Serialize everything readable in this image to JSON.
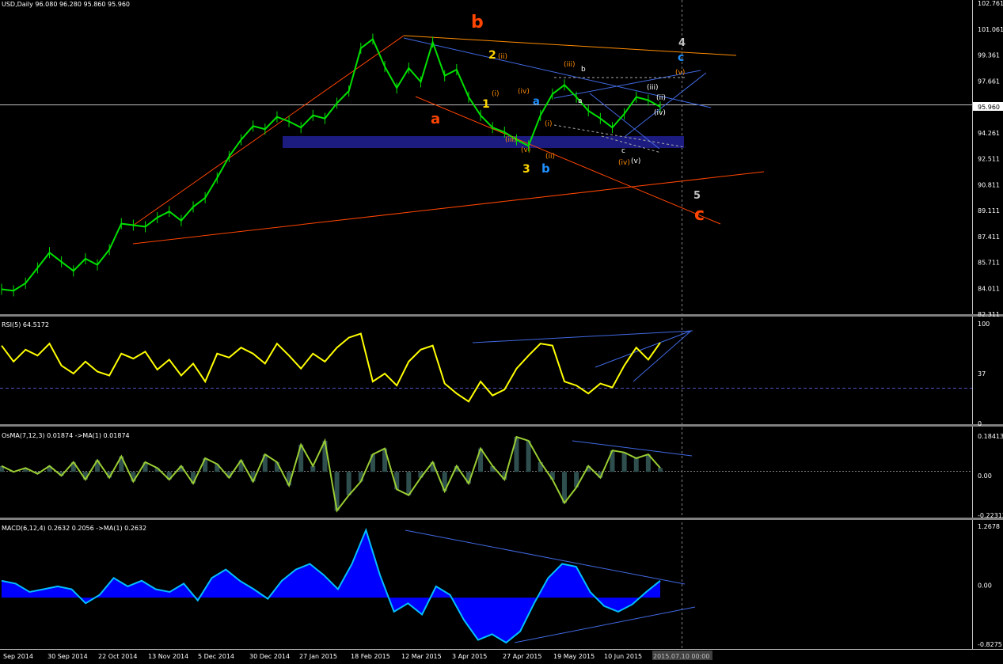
{
  "chart_data": {
    "type": "line",
    "title": "USD,Daily  96.080 96.280 95.860 95.960",
    "x_labels": [
      "Sep 2014",
      "30 Sep 2014",
      "22 Oct 2014",
      "13 Nov 2014",
      "5 Dec 2014",
      "30 Dec 2014",
      "27 Jan 2015",
      "18 Feb 2015",
      "12 Mar 2015",
      "3 Apr 2015",
      "27 Apr 2015",
      "19 May 2015",
      "10 Jun 2015",
      "2015.07.10 00:00"
    ],
    "panels": [
      {
        "name": "price",
        "header": "USD,Daily  96.080 96.280 95.860 95.960",
        "y_ticks": [
          "102.761",
          "101.061",
          "99.361",
          "97.661",
          "95.960",
          "94.261",
          "92.511",
          "90.811",
          "89.111",
          "87.411",
          "85.711",
          "84.011",
          "82.311"
        ],
        "ylim": [
          82.311,
          102.761
        ],
        "current_value": "95.960",
        "series": [
          {
            "name": "USD",
            "values": [
              84.0,
              83.9,
              84.4,
              85.4,
              86.4,
              85.8,
              85.2,
              86.0,
              85.6,
              86.6,
              88.3,
              88.2,
              88.1,
              88.7,
              89.1,
              88.5,
              89.4,
              90.0,
              91.3,
              92.7,
              93.8,
              94.7,
              94.5,
              95.3,
              95.0,
              94.6,
              95.4,
              95.2,
              96.2,
              97.0,
              99.8,
              100.4,
              98.6,
              97.2,
              98.5,
              97.6,
              100.2,
              98.0,
              98.4,
              96.6,
              95.4,
              94.6,
              94.3,
              93.8,
              93.4,
              95.4,
              96.8,
              97.4,
              96.6,
              95.7,
              95.2,
              94.6,
              95.5,
              96.6,
              96.4,
              95.96
            ]
          }
        ]
      },
      {
        "name": "rsi",
        "header": "RSI(5) 64.5172",
        "y_ticks": [
          "100",
          "37",
          "0"
        ],
        "ylim": [
          0,
          100
        ],
        "series": [
          {
            "name": "RSI",
            "values": [
              78,
              62,
              74,
              68,
              80,
              58,
              50,
              62,
              52,
              48,
              70,
              65,
              72,
              54,
              64,
              48,
              60,
              42,
              70,
              66,
              76,
              70,
              60,
              80,
              68,
              55,
              70,
              62,
              76,
              86,
              90,
              42,
              50,
              38,
              62,
              74,
              78,
              40,
              30,
              22,
              42,
              28,
              34,
              55,
              68,
              80,
              78,
              42,
              38,
              30,
              40,
              36,
              58,
              76,
              64,
              81
            ]
          }
        ]
      },
      {
        "name": "osma",
        "header": "OsMA(7,12,3) 0.01874  ->MA(1) 0.01874",
        "y_ticks": [
          "0.18413",
          "0.00",
          "-0.22312"
        ],
        "ylim": [
          -0.22312,
          0.18413
        ],
        "series": [
          {
            "name": "OsMA",
            "values": [
              0.03,
              0.0,
              0.02,
              -0.01,
              0.03,
              -0.02,
              0.05,
              -0.04,
              0.06,
              -0.03,
              0.08,
              -0.05,
              0.05,
              0.02,
              -0.04,
              0.03,
              -0.06,
              0.07,
              0.04,
              -0.03,
              0.06,
              -0.05,
              0.09,
              0.05,
              -0.07,
              0.14,
              0.03,
              0.16,
              -0.2,
              -0.12,
              -0.05,
              0.09,
              0.12,
              -0.09,
              -0.12,
              -0.03,
              0.05,
              -0.1,
              0.03,
              -0.06,
              0.12,
              0.03,
              -0.04,
              0.18,
              0.16,
              0.05,
              -0.04,
              -0.16,
              -0.08,
              0.03,
              -0.03,
              0.11,
              0.1,
              0.07,
              0.09,
              0.02
            ]
          }
        ]
      },
      {
        "name": "macd",
        "header": "MACD(6,12,4) 0.2632 0.2056  ->MA(1) 0.2632",
        "y_ticks": [
          "1.2678",
          "0.00",
          "-0.8275"
        ],
        "ylim": [
          -0.8275,
          1.2678
        ],
        "series": [
          {
            "name": "MACD",
            "values": [
              0.3,
              0.25,
              0.1,
              0.15,
              0.2,
              0.15,
              -0.1,
              0.05,
              0.35,
              0.2,
              0.3,
              0.15,
              0.1,
              0.25,
              -0.05,
              0.35,
              0.5,
              0.3,
              0.15,
              -0.02,
              0.3,
              0.5,
              0.6,
              0.4,
              0.15,
              0.6,
              1.2,
              0.4,
              -0.25,
              -0.1,
              -0.3,
              0.2,
              0.05,
              -0.4,
              -0.75,
              -0.65,
              -0.8,
              -0.6,
              -0.1,
              0.35,
              0.6,
              0.55,
              0.1,
              -0.15,
              -0.25,
              -0.12,
              0.1,
              0.3
            ]
          }
        ]
      }
    ],
    "wave_labels": [
      "b",
      "2",
      "1",
      "3",
      "a",
      "b",
      "a",
      "4",
      "c",
      "5",
      "c",
      "(i)",
      "(ii)",
      "(iii)",
      "(iv)",
      "(v)",
      "(i)",
      "(ii)",
      "(iii)",
      "(iv)",
      "(v)",
      "a",
      "b",
      "c",
      "(ii)",
      "(iii)",
      "(iv)",
      "(v)"
    ],
    "grid": false,
    "colors": {
      "background": "#000000",
      "price_bars": "#00e000",
      "rsi": "#ffff00",
      "osma_line": "#9acd32",
      "osma_hist": "#2f4f4f",
      "macd_line": "#00bfff",
      "macd_hist": "#0000ff",
      "trendline": "#4169e1",
      "channel": "#ff4500",
      "zone": "#1c1c80",
      "axis_text": "#ffffff"
    }
  }
}
